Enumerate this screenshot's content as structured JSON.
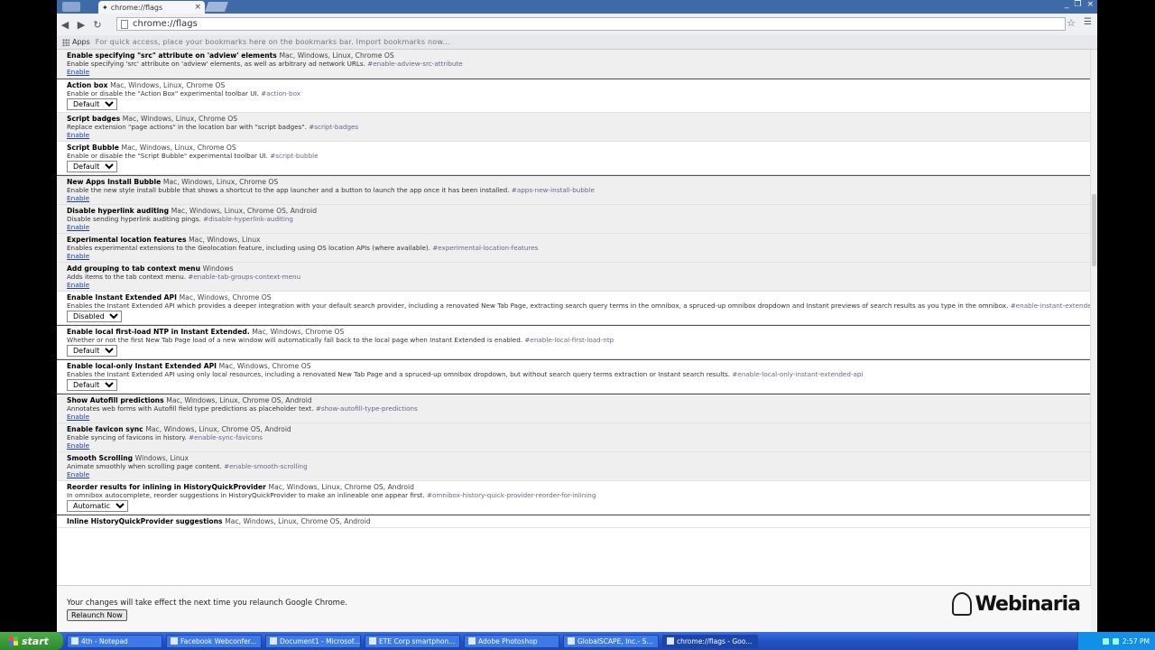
{
  "browser": {
    "tab_title": "chrome://flags",
    "tab_close": "×",
    "address": "chrome://flags",
    "window_buttons": [
      "_",
      "❐",
      "×"
    ]
  },
  "bookmarks": {
    "apps_label": "Apps",
    "hint": "For quick access, place your bookmarks here on the bookmarks bar. Import bookmarks now..."
  },
  "experiments": [
    {
      "title": "Enable specifying \"src\" attribute on 'adview' elements",
      "platforms": "Mac, Windows, Linux, Chrome OS",
      "desc": "Enable specifying 'src' attribute on 'adview' elements, as well as arbitrary ad network URLs.",
      "anchor": "#enable-adview-src-attribute",
      "control": "link",
      "link": "Enable",
      "unsupported": true
    },
    {
      "title": "Action box",
      "platforms": "Mac, Windows, Linux, Chrome OS",
      "desc": "Enable or disable the \"Action Box\" experimental toolbar UI.",
      "anchor": "#action-box",
      "control": "select",
      "value": "Default",
      "unsupported": false,
      "topline": true
    },
    {
      "title": "Script badges",
      "platforms": "Mac, Windows, Linux, Chrome OS",
      "desc": "Replace extension \"page actions\" in the location bar with \"script badges\".",
      "anchor": "#script-badges",
      "control": "link",
      "link": "Enable",
      "unsupported": true
    },
    {
      "title": "Script Bubble",
      "platforms": "Mac, Windows, Linux, Chrome OS",
      "desc": "Enable or disable the \"Script Bubble\" experimental toolbar UI.",
      "anchor": "#script-bubble",
      "control": "select",
      "value": "Default",
      "unsupported": false
    },
    {
      "title": "New Apps Install Bubble",
      "platforms": "Mac, Windows, Linux, Chrome OS",
      "desc": "Enable the new style install bubble that shows a shortcut to the app launcher and a button to launch the app once it has been installed.",
      "anchor": "#apps-new-install-bubble",
      "control": "link",
      "link": "Enable",
      "unsupported": true,
      "topline": true
    },
    {
      "title": "Disable hyperlink auditing",
      "platforms": "Mac, Windows, Linux, Chrome OS, Android",
      "desc": "Disable sending hyperlink auditing pings.",
      "anchor": "#disable-hyperlink-auditing",
      "control": "link",
      "link": "Enable",
      "unsupported": true
    },
    {
      "title": "Experimental location features",
      "platforms": "Mac, Windows, Linux",
      "desc": "Enables experimental extensions to the Geolocation feature, including using OS location APIs (where available).",
      "anchor": "#experimental-location-features",
      "control": "link",
      "link": "Enable",
      "unsupported": true
    },
    {
      "title": "Add grouping to tab context menu",
      "platforms": "Windows",
      "desc": "Adds items to the tab context menu.",
      "anchor": "#enable-tab-groups-context-menu",
      "control": "link",
      "link": "Enable",
      "unsupported": true
    },
    {
      "title": "Enable Instant Extended API",
      "platforms": "Mac, Windows, Chrome OS",
      "desc": "Enables the Instant Extended API which provides a deeper integration with your default search provider, including a renovated New Tab Page, extracting search query terms in the omnibox, a spruced-up omnibox dropdown and Instant previews of search results as you type in the omnibox.",
      "anchor": "#enable-instant-extended-api",
      "control": "select",
      "value": "Disabled",
      "unsupported": false
    },
    {
      "title": "Enable local first-load NTP in Instant Extended.",
      "platforms": "Mac, Windows, Chrome OS",
      "desc": "Whether or not the first New Tab Page load of a new window will automatically fall back to the local page when Instant Extended is enabled.",
      "anchor": "#enable-local-first-load-ntp",
      "control": "select",
      "value": "Default",
      "unsupported": false,
      "topline": true
    },
    {
      "title": "Enable local-only Instant Extended API",
      "platforms": "Mac, Windows, Chrome OS",
      "desc": "Enables the Instant Extended API using only local resources, including a renovated New Tab Page and a spruced-up omnibox dropdown, but without search query terms extraction or Instant search results.",
      "anchor": "#enable-local-only-instant-extended-api",
      "control": "select",
      "value": "Default",
      "unsupported": false,
      "topline": true
    },
    {
      "title": "Show Autofill predictions",
      "platforms": "Mac, Windows, Linux, Chrome OS, Android",
      "desc": "Annotates web forms with Autofill field type predictions as placeholder text.",
      "anchor": "#show-autofill-type-predictions",
      "control": "link",
      "link": "Enable",
      "unsupported": true,
      "topline": true
    },
    {
      "title": "Enable favicon sync",
      "platforms": "Mac, Windows, Linux, Chrome OS, Android",
      "desc": "Enable syncing of favicons in history.",
      "anchor": "#enable-sync-favicons",
      "control": "link",
      "link": "Enable",
      "unsupported": true
    },
    {
      "title": "Smooth Scrolling",
      "platforms": "Windows, Linux",
      "desc": "Animate smoothly when scrolling page content.",
      "anchor": "#enable-smooth-scrolling",
      "control": "link",
      "link": "Enable",
      "unsupported": true
    },
    {
      "title": "Reorder results for inlining in HistoryQuickProvider",
      "platforms": "Mac, Windows, Linux, Chrome OS, Android",
      "desc": "In omnibox autocomplete, reorder suggestions in HistoryQuickProvider to make an inlineable one appear first.",
      "anchor": "#omnibox-history-quick-provider-reorder-for-inlining",
      "control": "select",
      "value": "Automatic",
      "unsupported": false
    },
    {
      "title": "Inline HistoryQuickProvider suggestions",
      "platforms": "Mac, Windows, Linux, Chrome OS, Android",
      "desc": "",
      "anchor": "",
      "control": "none",
      "unsupported": false,
      "topline": true
    }
  ],
  "relaunch": {
    "message": "Your changes will take effect the next time you relaunch Google Chrome.",
    "button": "Relaunch Now"
  },
  "watermark": "Webinaria",
  "taskbar": {
    "start_label": "start",
    "tasks": [
      {
        "label": "4th - Notepad",
        "active": false
      },
      {
        "label": "Facebook Webconfer...",
        "active": false
      },
      {
        "label": "Document1 - Microsof...",
        "active": false
      },
      {
        "label": "ETE Corp smartphon...",
        "active": false
      },
      {
        "label": "Adobe Photoshop",
        "active": false
      },
      {
        "label": "GlobalSCAPE, Inc.- S...",
        "active": false
      },
      {
        "label": "chrome://flags - Goo...",
        "active": true
      }
    ],
    "clock": "2:57 PM"
  }
}
